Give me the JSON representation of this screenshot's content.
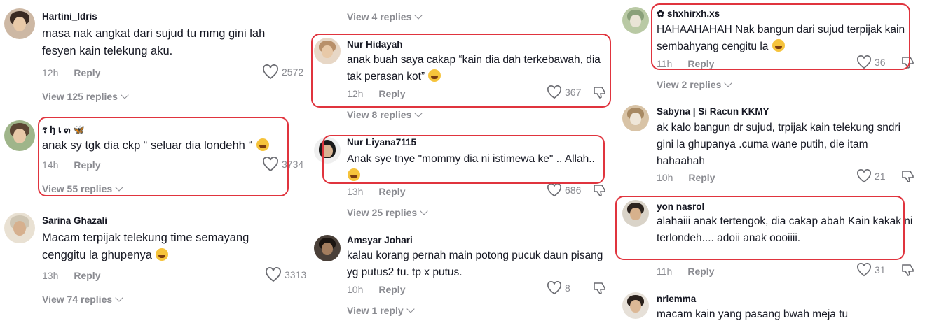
{
  "col1": {
    "comments": [
      {
        "user": "Hartini_Idris",
        "text": "masa nak angkat dari sujud tu mmg gini lah fesyen kain telekung aku.",
        "time": "12h",
        "reply": "Reply",
        "likes": "2572",
        "view": "View 125 replies"
      },
      {
        "user": "ร ђ เ ๓ 🦋",
        "text": "anak sy tgk dia ckp “ seluar dia londehh “",
        "time": "14h",
        "reply": "Reply",
        "likes": "3734",
        "view": "View 55 replies"
      },
      {
        "user": "Sarina Ghazali",
        "text": "Macam terpijak telekung time semayang cenggitu la ghupenya",
        "time": "13h",
        "reply": "Reply",
        "likes": "3313",
        "view": "View 74 replies"
      }
    ]
  },
  "col2": {
    "top_view": "View 4 replies",
    "comments": [
      {
        "user": "Nur Hidayah",
        "text": "anak buah saya cakap “kain dia dah terkebawah, dia tak perasan kot”",
        "time": "12h",
        "reply": "Reply",
        "likes": "367",
        "view": "View 8 replies"
      },
      {
        "user": "Nur Liyana7115",
        "text": "Anak sye tnye \"mommy dia ni istimewa ke\" .. Allah..",
        "time": "13h",
        "reply": "Reply",
        "likes": "686",
        "view": "View 25 replies"
      },
      {
        "user": "Amsyar Johari",
        "text": "kalau korang pernah main potong pucuk daun pisang yg putus2 tu. tp x putus.",
        "time": "10h",
        "reply": "Reply",
        "likes": "8",
        "view": "View 1 reply"
      }
    ]
  },
  "col3": {
    "comments": [
      {
        "user": "✿ shxhirxh.xs",
        "text": "HAHAAHAHAH Nak bangun dari sujud terpijak kain sembahyang cengitu la",
        "time": "11h",
        "reply": "Reply",
        "likes": "36",
        "view": "View 2 replies"
      },
      {
        "user": "Sabyna | Si Racun KKMY",
        "text": "ak kalo bangun dr sujud, trpijak kain telekung sndri  gini la ghupanya .cuma wane putih, die itam hahaahah",
        "time": "10h",
        "reply": "Reply",
        "likes": "21"
      },
      {
        "user": "yon nasrol",
        "text": "alahaiii anak tertengok, dia cakap abah Kain kakak ni terlondeh.... adoii anak oooiiii.",
        "time": "11h",
        "reply": "Reply",
        "likes": "31"
      },
      {
        "user": "nrlemma",
        "text": "macam kain yang pasang bwah meja tu"
      }
    ]
  },
  "colors": {
    "highlight": "#e0343e",
    "muted": "#8a8b91",
    "text": "#161823"
  },
  "icons": {
    "like": "heart-outline-icon",
    "dislike": "thumbs-down-icon",
    "expand": "chevron-down-icon"
  }
}
